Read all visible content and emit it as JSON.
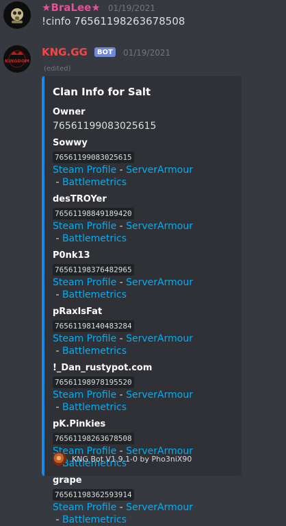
{
  "messages": [
    {
      "author": "★BraLee★",
      "author_color": "#e74f9b",
      "timestamp": "01/19/2021",
      "content": "!cinfo 76561198263678508"
    },
    {
      "author": "KNG.GG",
      "author_color": "#f04747",
      "bot_tag": "BOT",
      "timestamp": "01/19/2021",
      "edited": "(edited)",
      "avatar_text": "KINGDOM",
      "embed": {
        "accent_color": "#1e88e5",
        "title": "Clan Info for Salt",
        "owner_label": "Owner",
        "owner_value": "76561199083025615",
        "link_separator": " - ",
        "link_labels": [
          "Steam Profile",
          "ServerArmour",
          "Battlemetrics"
        ],
        "members": [
          {
            "name": "Sowwy",
            "id": "76561199083025615"
          },
          {
            "name": "desTROYer",
            "id": "76561198849189420"
          },
          {
            "name": "P0nk13",
            "id": "76561198376482965"
          },
          {
            "name": "pRaxIsFat",
            "id": "76561198140483284"
          },
          {
            "name": "!_Dan_rustypot.com",
            "id": "76561198978195520"
          },
          {
            "name": "pK.Pinkies",
            "id": "76561198263678508"
          },
          {
            "name": "grape",
            "id": "76561198362593914"
          }
        ],
        "footer_text": "KNG Bot V1.9.1-0 by Pho3niX90"
      }
    }
  ]
}
